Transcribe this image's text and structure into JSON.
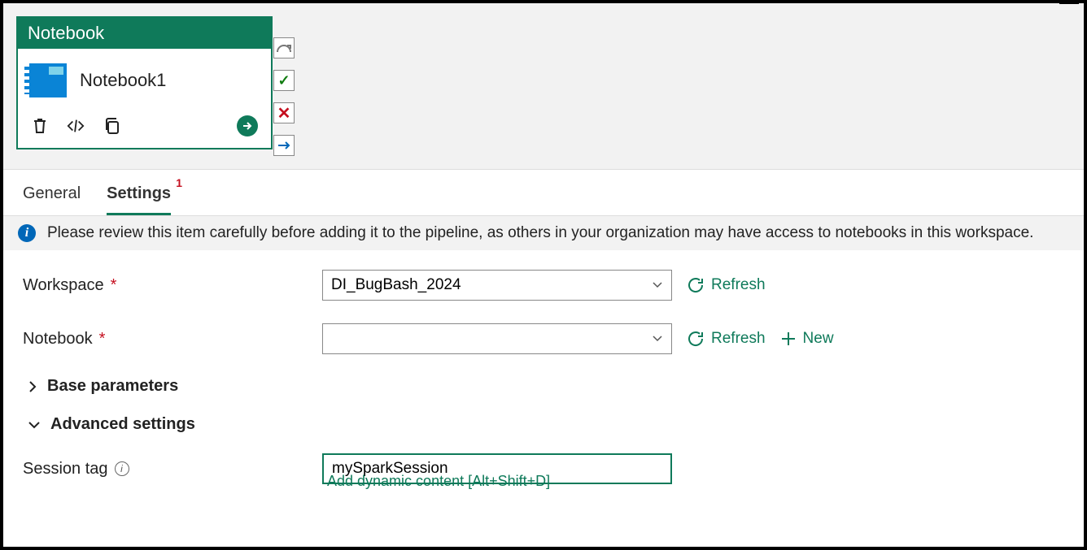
{
  "node": {
    "type_label": "Notebook",
    "name": "Notebook1"
  },
  "tabs": {
    "general": "General",
    "settings": "Settings",
    "settings_badge": "1"
  },
  "banner": {
    "text": "Please review this item carefully before adding it to the pipeline, as others in your organization may have access to notebooks in this workspace."
  },
  "form": {
    "workspace_label": "Workspace",
    "workspace_value": "DI_BugBash_2024",
    "notebook_label": "Notebook",
    "notebook_value": "",
    "refresh_label": "Refresh",
    "new_label": "New",
    "base_params_label": "Base parameters",
    "advanced_label": "Advanced settings",
    "session_tag_label": "Session tag",
    "session_tag_value": "mySparkSession",
    "dynamic_link": "Add dynamic content [Alt+Shift+D]"
  }
}
